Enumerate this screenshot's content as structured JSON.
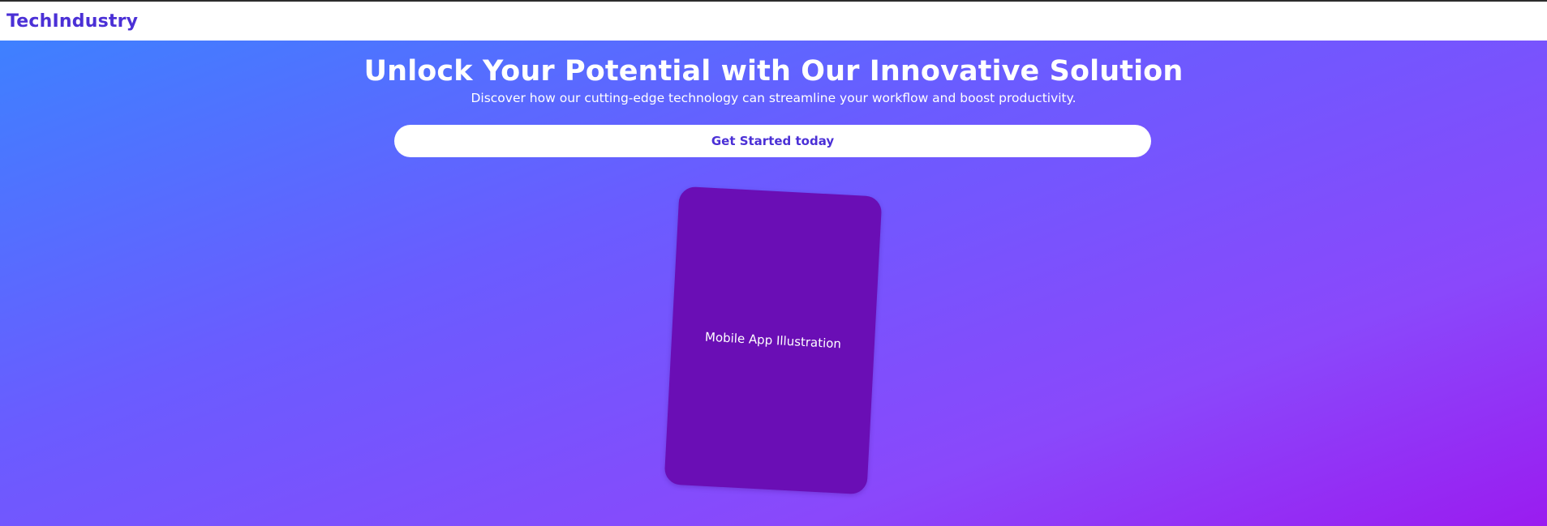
{
  "navbar": {
    "logo": "TechIndustry"
  },
  "hero": {
    "title": "Unlock Your Potential with Our Innovative Solution",
    "subtitle": "Discover how our cutting-edge technology can streamline your workflow and boost productivity.",
    "cta_label": "Get Started today"
  },
  "illustration": {
    "label": "Mobile App Illustration"
  },
  "colors": {
    "brand": "#4b30d6",
    "gradient_start": "#3a84ff",
    "gradient_end": "#9a1cf0",
    "phone": "#6a0eb5"
  }
}
